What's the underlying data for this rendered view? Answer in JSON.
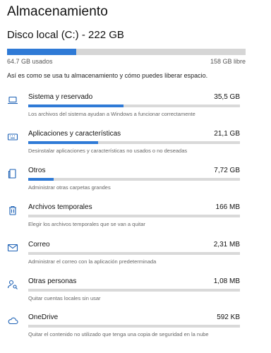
{
  "page": {
    "title": "Almacenamiento"
  },
  "drive": {
    "title": "Disco local (C:) - 222 GB",
    "used_label": "64.7 GB usados",
    "free_label": "158 GB libre",
    "used_fraction": 0.29
  },
  "intro": "Así es como se usa tu almacenamiento y cómo puedes liberar espacio.",
  "accent_color": "#2f7ad6",
  "categories": [
    {
      "name": "Sistema y reservado",
      "size": "35,5 GB",
      "description": "Los archivos del sistema ayudan a Windows a funcionar correctamente",
      "fill": 0.45,
      "icon": "laptop-icon"
    },
    {
      "name": "Aplicaciones y características",
      "size": "21,1 GB",
      "description": "Desinstalar aplicaciones y características no usados o no deseadas",
      "fill": 0.33,
      "icon": "keyboard-icon"
    },
    {
      "name": "Otros",
      "size": "7,72 GB",
      "description": "Administrar otras carpetas grandes",
      "fill": 0.12,
      "icon": "folder-icon"
    },
    {
      "name": "Archivos temporales",
      "size": "166 MB",
      "description": "Elegir los archivos temporales que se van a quitar",
      "fill": 0.0,
      "icon": "trash-icon"
    },
    {
      "name": "Correo",
      "size": "2,31 MB",
      "description": "Administrar el correo con la aplicación predeterminada",
      "fill": 0.0,
      "icon": "mail-icon"
    },
    {
      "name": "Otras personas",
      "size": "1,08 MB",
      "description": "Quitar cuentas locales sin usar",
      "fill": 0.0,
      "icon": "person-search-icon"
    },
    {
      "name": "OneDrive",
      "size": "592 KB",
      "description": "Quitar el contenido no utilizado que tenga una copia de seguridad en la nube",
      "fill": 0.0,
      "icon": "cloud-icon"
    }
  ]
}
